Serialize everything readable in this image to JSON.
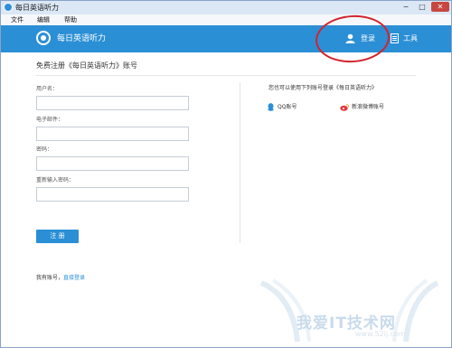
{
  "window": {
    "title": "每日英语听力",
    "controls": [
      "−",
      "□",
      "✕"
    ]
  },
  "menu": {
    "items": [
      "文件",
      "编辑",
      "帮助"
    ]
  },
  "appbar": {
    "brand": "每日英语听力",
    "login_label": "登录",
    "tools_label": "工具"
  },
  "colors": {
    "accent": "#2b8fd5",
    "annotation": "#d3232b"
  },
  "form": {
    "heading": "免费注册《每日英语听力》账号",
    "username_label": "用户名：",
    "email_label": "电子邮件：",
    "password_label": "密码：",
    "confirm_label": "重新输入密码：",
    "username_value": "",
    "email_value": "",
    "password_value": "",
    "confirm_value": "",
    "register_label": "注 册",
    "has_account": "我有账号，",
    "login_link": "直接登录"
  },
  "third_party": {
    "title": "您也可以使用下列账号登录《每日英语听力》",
    "qq": "QQ账号",
    "weibo": "新浪微博账号"
  },
  "watermark": {
    "text": "我爱IT技术网",
    "url": "www.52ij.com"
  },
  "icons": {
    "logo": "app-logo-icon",
    "login": "user-icon",
    "tools": "tools-icon",
    "qq": "qq-icon",
    "weibo": "weibo-icon"
  }
}
